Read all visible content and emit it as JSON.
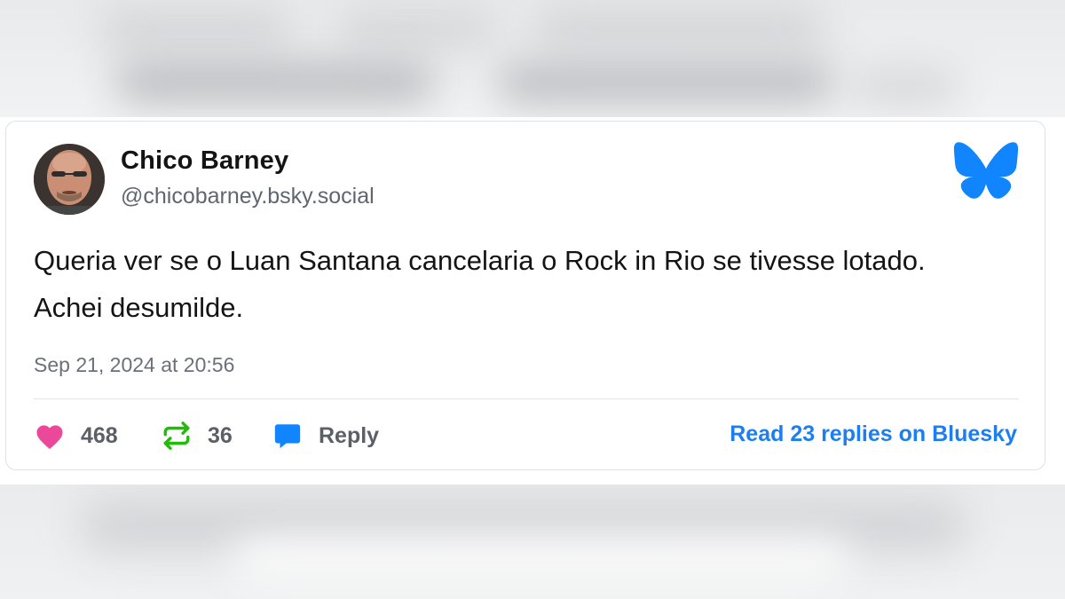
{
  "post": {
    "author": {
      "display_name": "Chico Barney",
      "handle": "@chicobarney.bsky.social"
    },
    "text_lines": [
      "Queria ver se o Luan Santana cancelaria o Rock in Rio se tivesse lotado.",
      "Achei desumilde."
    ],
    "timestamp": "Sep 21, 2024 at 20:56"
  },
  "actions": {
    "likes_count": "468",
    "reposts_count": "36",
    "reply_label": "Reply",
    "read_replies_label": "Read 23 replies on Bluesky"
  },
  "icons": {
    "logo": "bluesky-butterfly-icon",
    "like": "heart-icon",
    "repost": "repost-icon",
    "reply": "speech-bubble-icon"
  },
  "colors": {
    "brand_blue": "#1185fe",
    "like_pink": "#ec4899",
    "repost_green": "#20bc07",
    "link_blue": "#1d7ef0"
  }
}
